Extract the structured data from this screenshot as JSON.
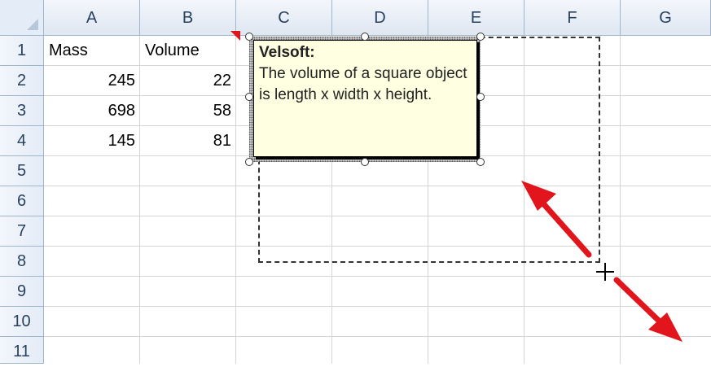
{
  "columns": [
    "A",
    "B",
    "C",
    "D",
    "E",
    "F",
    "G"
  ],
  "rows": [
    "1",
    "2",
    "3",
    "4",
    "5",
    "6",
    "7",
    "8",
    "9",
    "10",
    "11"
  ],
  "cells": {
    "a1": "Mass",
    "b1": "Volume",
    "a2": "245",
    "b2": "22",
    "a3": "698",
    "b3": "58",
    "a4": "145",
    "b4": "81"
  },
  "comment": {
    "author": "Velsoft:",
    "text": "The volume of a square object is length x width x height."
  },
  "colors": {
    "comment_background": "#ffffe1",
    "arrow": "#e1151b",
    "header_background": "#dfe7f2"
  },
  "icons": {
    "crosshair": "resize-crosshair-icon",
    "arrows": "drag-direction-arrow-icon"
  }
}
